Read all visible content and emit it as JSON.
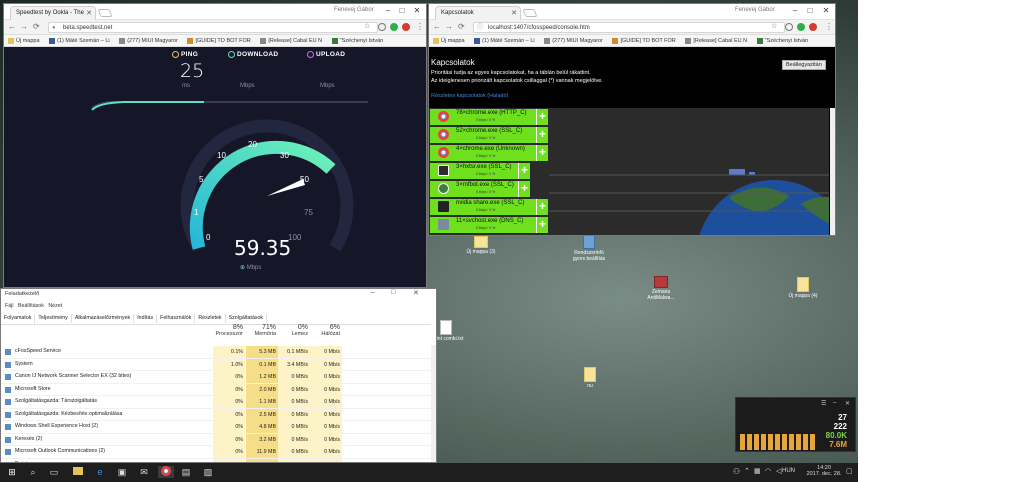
{
  "speedtest_window": {
    "tab_title": "Speedtest by Ookla - The",
    "user": "Fenevej Gábor",
    "url": "beta.speedtest.net",
    "bookmarks": [
      "Új mappa",
      "(1) Máté Szemán – Li",
      "(277) MIUI Magyaror",
      "[GUIDE] TO BOT FOR",
      "[Release] Cabal EU N",
      "\"Széchenyi István"
    ],
    "ping_label": "PING",
    "download_label": "DOWNLOAD",
    "upload_label": "UPLOAD",
    "ping_value": "25",
    "ping_unit": "ms",
    "download_unit": "Mbps",
    "upload_unit": "Mbps",
    "gauge_ticks": [
      "0",
      "1",
      "5",
      "10",
      "20",
      "30",
      "50",
      "75",
      "100"
    ],
    "speed_value": "59.35",
    "speed_unit": "Mbps"
  },
  "cfos_window": {
    "tab_title": "Kapcsolatok",
    "user": "Fenevej Gábor",
    "url": "localhost:1407/cfosspeed/console.htm",
    "bookmarks": [
      "Új mappa",
      "(1) Máté Szemán – Li",
      "(277) MIUI Magyaror",
      "[GUIDE] TO BOT FOR",
      "[Release] Cabal EU N",
      "\"Széchenyi István"
    ],
    "heading": "Kapcsolatok",
    "desc1": "Prioritási tudja az egyes kapcsolatokat, ha a táblán belül rákattint.",
    "desc2": "Az ideiglenesen priorizált kapcsolatok csillaggal (*) vannak megjelölve.",
    "link": "Részletes kapcsolatok (Haladó)",
    "settings_button": "Beállegyazitán",
    "connections": [
      {
        "name": "78×chrome.exe (HTTP_C)",
        "sub": "0 kbps / 0 %",
        "icon_color": "#e94b35"
      },
      {
        "name": "52×chrome.exe (SSL_C)",
        "sub": "0 kbps / 0 %",
        "icon_color": "#e94b35"
      },
      {
        "name": "4×chrome.exe (Unknown)",
        "sub": "0 kbps / 0 %",
        "icon_color": "#e94b35"
      },
      {
        "name": "3×hxtsr.exe (SSL_C)",
        "sub": "0 kbps / 0 %",
        "icon_color": "#2c2c2c"
      },
      {
        "name": "3×mfbot.exe (SSL_C)",
        "sub": "0 kbps / 0 %",
        "icon_color": "#3f7d3b"
      },
      {
        "name": "nvidia share.exe (SSL_C)",
        "sub": "0 kbps / 0 %",
        "icon_color": "#222222"
      },
      {
        "name": "11×svchost.exe (DNS_C)",
        "sub": "0 kbps / 0 %",
        "icon_color": "#7a8aa0"
      }
    ]
  },
  "task_manager": {
    "title": "Feladatkezelő",
    "menu": [
      "Fájl",
      "Beállítások",
      "Nézet"
    ],
    "tabs": [
      "Folyamatok",
      "Teljesítmény",
      "Alkalmazáselőzmények",
      "Indítás",
      "Felhasználók",
      "Részletek",
      "Szolgáltatások"
    ],
    "columns": [
      {
        "pct": "8%",
        "label": "Processzor"
      },
      {
        "pct": "71%",
        "label": "Memória"
      },
      {
        "pct": "0%",
        "label": "Lemez"
      },
      {
        "pct": "6%",
        "label": "Hálózat"
      }
    ],
    "processes": [
      {
        "name": "cFosSpeed Service",
        "cpu": "0.1%",
        "mem": "5.3 MB",
        "disk": "0.1 MB/s",
        "net": "0 Mb/s"
      },
      {
        "name": "System",
        "cpu": "1.0%",
        "mem": "0.1 MB",
        "disk": "3.4 MB/s",
        "net": "0 Mb/s"
      },
      {
        "name": "Canon IJ Network Scanner Selector EX (32 bites)",
        "cpu": "0%",
        "mem": "1.2 MB",
        "disk": "0 MB/s",
        "net": "0 Mb/s"
      },
      {
        "name": "Microsoft Store",
        "cpu": "0%",
        "mem": "2.0 MB",
        "disk": "0 MB/s",
        "net": "0 Mb/s"
      },
      {
        "name": "Szolgáltatásgazda: Társzolgáltatás",
        "cpu": "0%",
        "mem": "1.1 MB",
        "disk": "0 MB/s",
        "net": "0 Mb/s"
      },
      {
        "name": "Szolgáltatásgazda: Kézbesítés optimalizálása",
        "cpu": "0%",
        "mem": "2.5 MB",
        "disk": "0 MB/s",
        "net": "0 Mb/s"
      },
      {
        "name": "Windows Shell Experience Host (2)",
        "cpu": "0%",
        "mem": "4.8 MB",
        "disk": "0 MB/s",
        "net": "0 Mb/s"
      },
      {
        "name": "Keresés (2)",
        "cpu": "0%",
        "mem": "3.2 MB",
        "disk": "0 MB/s",
        "net": "0 Mb/s"
      },
      {
        "name": "Microsoft Outlook Communications (2)",
        "cpu": "0%",
        "mem": "11.9 MB",
        "disk": "0 MB/s",
        "net": "0 Mb/s"
      },
      {
        "name": "Paint",
        "cpu": "0%",
        "mem": "2.1 MB",
        "disk": "0 MB/s",
        "net": "0 Mb/s"
      }
    ]
  },
  "desktop": {
    "icons": [
      {
        "label": "Új mappa (3)",
        "kind": "folder"
      },
      {
        "label": "Rendszerinfó gyors beállítás",
        "kind": "app"
      },
      {
        "label": "Zemana AntiMalwa...",
        "kind": "app"
      },
      {
        "label": "Új mappa (4)",
        "kind": "folder"
      },
      {
        "label": "c mint combi.txt",
        "kind": "doc"
      },
      {
        "label": "nu",
        "kind": "folder"
      }
    ]
  },
  "netmeter": {
    "v1": "27",
    "v2": "222",
    "v3": "80.0K",
    "v4": "7.6M"
  },
  "taskbar": {
    "lang": "HUN",
    "time": "14:20",
    "date": "2017. dec. 28."
  }
}
